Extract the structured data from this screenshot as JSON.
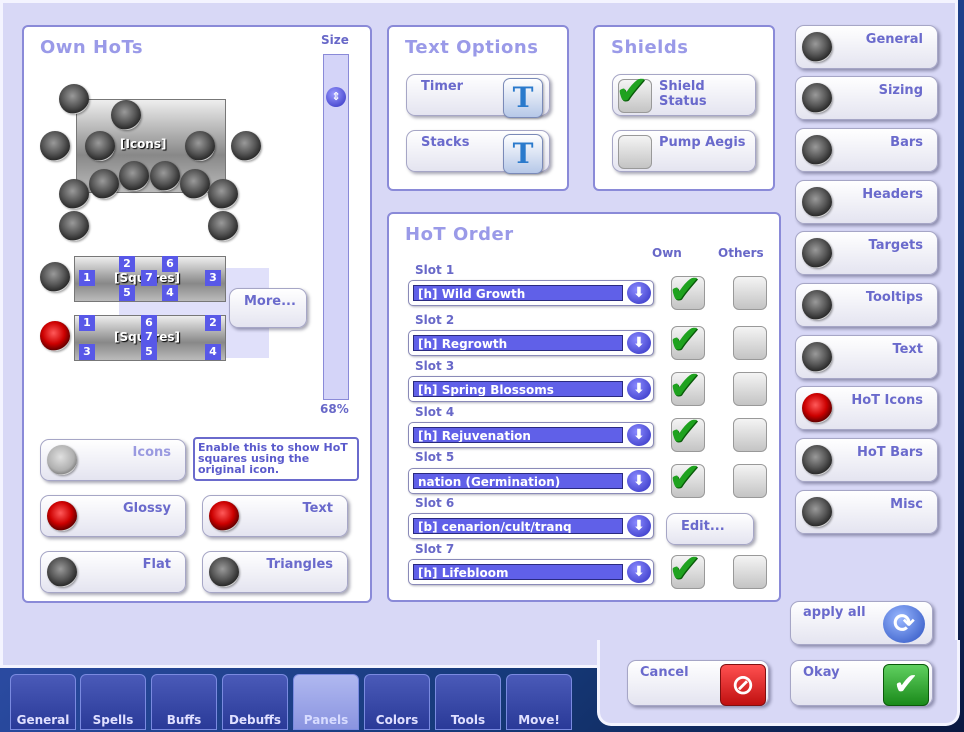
{
  "own_hots": {
    "title": "Own HoTs",
    "size_label": "Size",
    "size_value": "68%",
    "size_level": 0.1,
    "icons_label": "[Icons]",
    "squares_label_1": "[Squares]",
    "squares_label_2": "[Squares]",
    "more_button": "More...",
    "squares_row1": [
      "2",
      "6",
      "1",
      "7",
      "3",
      "5",
      "4"
    ],
    "squares_row2": [
      "1",
      "6",
      "2",
      "7",
      "3",
      "5",
      "4"
    ],
    "icons_toggle": "Icons",
    "tooltip": "Enable this to show HoT squares using the original icon.",
    "glossy": "Glossy",
    "text": "Text",
    "flat": "Flat",
    "triangles": "Triangles"
  },
  "text_options": {
    "title": "Text Options",
    "timer": "Timer",
    "stacks": "Stacks",
    "icon_glyph": "T"
  },
  "shields": {
    "title": "Shields",
    "shield_status": "Shield Status",
    "pump_aegis": "Pump Aegis"
  },
  "hot_order": {
    "title": "HoT Order",
    "own_header": "Own",
    "others_header": "Others",
    "edit_button": "Edit...",
    "slots": [
      {
        "label": "Slot 1",
        "value": "[h] Wild Growth",
        "own": true,
        "others": false
      },
      {
        "label": "Slot 2",
        "value": "[h] Regrowth",
        "own": true,
        "others": false
      },
      {
        "label": "Slot 3",
        "value": "[h] Spring Blossoms",
        "own": true,
        "others": false
      },
      {
        "label": "Slot 4",
        "value": "[h] Rejuvenation",
        "own": true,
        "others": false
      },
      {
        "label": "Slot 5",
        "value": "nation (Germination)",
        "own": true,
        "others": false
      },
      {
        "label": "Slot 6",
        "value": "[b] cenarion/cult/tranq",
        "own": null,
        "others": null
      },
      {
        "label": "Slot 7",
        "value": "[h] Lifebloom",
        "own": true,
        "others": false
      }
    ]
  },
  "right_menu": [
    {
      "label": "General",
      "active": false
    },
    {
      "label": "Sizing",
      "active": false
    },
    {
      "label": "Bars",
      "active": false
    },
    {
      "label": "Headers",
      "active": false
    },
    {
      "label": "Targets",
      "active": false
    },
    {
      "label": "Tooltips",
      "active": false
    },
    {
      "label": "Text",
      "active": false
    },
    {
      "label": "HoT Icons",
      "active": true
    },
    {
      "label": "HoT Bars",
      "active": false
    },
    {
      "label": "Misc",
      "active": false
    }
  ],
  "footer": {
    "apply_all": "apply all",
    "cancel": "Cancel",
    "okay": "Okay"
  },
  "bottom_tabs": [
    "General",
    "Spells",
    "Buffs",
    "Debuffs",
    "Panels",
    "Colors",
    "Tools",
    "Move!"
  ],
  "selected_tab": "Panels",
  "colors": {
    "accent": "#6060e8",
    "check_green": "#1fa21f",
    "cancel_red": "#d02020"
  }
}
